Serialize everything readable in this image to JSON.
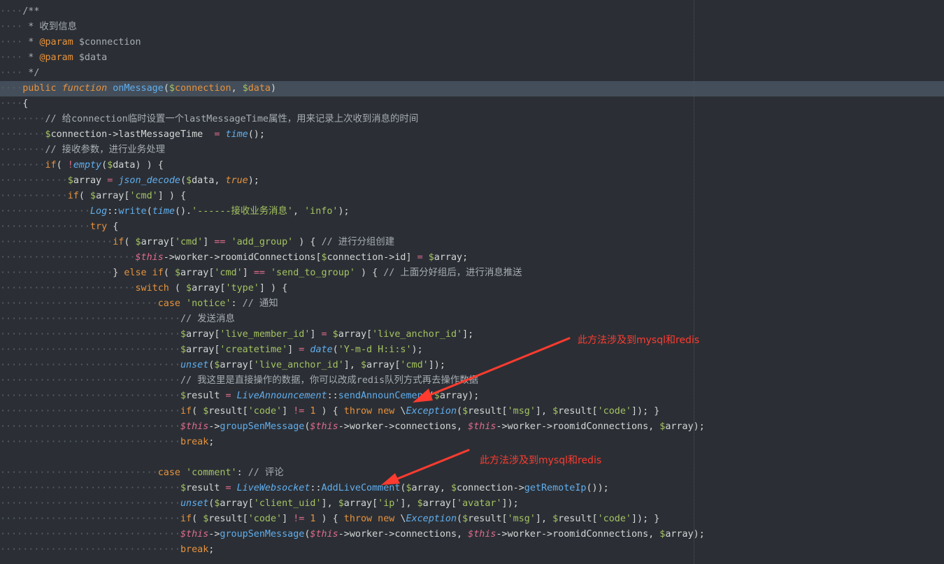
{
  "annotations": [
    "此方法涉及到mysql和redis",
    "此方法涉及到mysql和redis"
  ],
  "colors": {
    "background": "#2b2f35",
    "active_line": "#434e5a",
    "annotation": "#ff3b2f"
  },
  "code_lines": [
    {
      "indent": 1,
      "tokens": [
        [
          "comment",
          "/**"
        ]
      ]
    },
    {
      "indent": 1,
      "tokens": [
        [
          "comment",
          " * 收到信息"
        ]
      ]
    },
    {
      "indent": 1,
      "tokens": [
        [
          "comment",
          " * "
        ],
        [
          "param",
          "@param"
        ],
        [
          "comment",
          " $connection"
        ]
      ]
    },
    {
      "indent": 1,
      "tokens": [
        [
          "comment",
          " * "
        ],
        [
          "param",
          "@param"
        ],
        [
          "comment",
          " $data"
        ]
      ]
    },
    {
      "indent": 1,
      "tokens": [
        [
          "comment",
          " */"
        ]
      ]
    },
    {
      "indent": 1,
      "active": true,
      "tokens": [
        [
          "kw",
          "public"
        ],
        [
          "punc",
          " "
        ],
        [
          "fn-kw",
          "function"
        ],
        [
          "punc",
          " "
        ],
        [
          "func",
          "onMessage"
        ],
        [
          "punc",
          "("
        ],
        [
          "dollar",
          "$"
        ],
        [
          "kw",
          "connection"
        ],
        [
          "punc",
          ", "
        ],
        [
          "dollar",
          "$"
        ],
        [
          "kw",
          "data"
        ],
        [
          "punc",
          ")"
        ]
      ]
    },
    {
      "indent": 1,
      "tokens": [
        [
          "punc",
          "{"
        ]
      ]
    },
    {
      "indent": 2,
      "tokens": [
        [
          "comment",
          "// 给connection临时设置一个lastMessageTime属性，用来记录上次收到消息的时间"
        ]
      ]
    },
    {
      "indent": 2,
      "tokens": [
        [
          "dollar",
          "$"
        ],
        [
          "var",
          "connection->lastMessageTime  "
        ],
        [
          "op",
          "="
        ],
        [
          "punc",
          " "
        ],
        [
          "builtin",
          "time"
        ],
        [
          "punc",
          "();"
        ]
      ]
    },
    {
      "indent": 2,
      "tokens": [
        [
          "comment",
          "// 接收参数，进行业务处理"
        ]
      ]
    },
    {
      "indent": 2,
      "tokens": [
        [
          "kw",
          "if"
        ],
        [
          "punc",
          "( "
        ],
        [
          "op",
          "!"
        ],
        [
          "builtin",
          "empty"
        ],
        [
          "punc",
          "("
        ],
        [
          "dollar",
          "$"
        ],
        [
          "var",
          "data"
        ],
        [
          "punc",
          ") ) {"
        ]
      ]
    },
    {
      "indent": 3,
      "tokens": [
        [
          "dollar",
          "$"
        ],
        [
          "var",
          "array "
        ],
        [
          "op",
          "="
        ],
        [
          "punc",
          " "
        ],
        [
          "builtin",
          "json_decode"
        ],
        [
          "punc",
          "("
        ],
        [
          "dollar",
          "$"
        ],
        [
          "var",
          "data"
        ],
        [
          "punc",
          ", "
        ],
        [
          "true",
          "true"
        ],
        [
          "punc",
          ");"
        ]
      ]
    },
    {
      "indent": 3,
      "tokens": [
        [
          "kw",
          "if"
        ],
        [
          "punc",
          "( "
        ],
        [
          "dollar",
          "$"
        ],
        [
          "var",
          "array"
        ],
        [
          "punc",
          "["
        ],
        [
          "str",
          "'cmd'"
        ],
        [
          "punc",
          "] ) {"
        ]
      ]
    },
    {
      "indent": 4,
      "tokens": [
        [
          "class",
          "Log"
        ],
        [
          "punc",
          "::"
        ],
        [
          "method",
          "write"
        ],
        [
          "punc",
          "("
        ],
        [
          "builtin",
          "time"
        ],
        [
          "punc",
          "()."
        ],
        [
          "str",
          "'------接收业务消息'"
        ],
        [
          "punc",
          ", "
        ],
        [
          "str",
          "'info'"
        ],
        [
          "punc",
          ");"
        ]
      ]
    },
    {
      "indent": 4,
      "tokens": [
        [
          "kw",
          "try"
        ],
        [
          "punc",
          " {"
        ]
      ]
    },
    {
      "indent": 5,
      "tokens": [
        [
          "kw",
          "if"
        ],
        [
          "punc",
          "( "
        ],
        [
          "dollar",
          "$"
        ],
        [
          "var",
          "array"
        ],
        [
          "punc",
          "["
        ],
        [
          "str",
          "'cmd'"
        ],
        [
          "punc",
          "] "
        ],
        [
          "op",
          "=="
        ],
        [
          "punc",
          " "
        ],
        [
          "str",
          "'add_group'"
        ],
        [
          "punc",
          " ) { "
        ],
        [
          "comment",
          "// 进行分组创建"
        ]
      ]
    },
    {
      "indent": 6,
      "tokens": [
        [
          "this",
          "$this"
        ],
        [
          "var",
          "->worker->roomidConnections["
        ],
        [
          "dollar",
          "$"
        ],
        [
          "var",
          "connection->id] "
        ],
        [
          "op",
          "="
        ],
        [
          "punc",
          " "
        ],
        [
          "dollar",
          "$"
        ],
        [
          "var",
          "array;"
        ]
      ]
    },
    {
      "indent": 5,
      "tokens": [
        [
          "punc",
          "} "
        ],
        [
          "kw",
          "else if"
        ],
        [
          "punc",
          "( "
        ],
        [
          "dollar",
          "$"
        ],
        [
          "var",
          "array"
        ],
        [
          "punc",
          "["
        ],
        [
          "str",
          "'cmd'"
        ],
        [
          "punc",
          "] "
        ],
        [
          "op",
          "=="
        ],
        [
          "punc",
          " "
        ],
        [
          "str",
          "'send_to_group'"
        ],
        [
          "punc",
          " ) { "
        ],
        [
          "comment",
          "// 上面分好组后，进行消息推送"
        ]
      ]
    },
    {
      "indent": 6,
      "tokens": [
        [
          "kw",
          "switch"
        ],
        [
          "punc",
          " ( "
        ],
        [
          "dollar",
          "$"
        ],
        [
          "var",
          "array"
        ],
        [
          "punc",
          "["
        ],
        [
          "str",
          "'type'"
        ],
        [
          "punc",
          "] ) {"
        ]
      ]
    },
    {
      "indent": 7,
      "tokens": [
        [
          "kw",
          "case"
        ],
        [
          "punc",
          " "
        ],
        [
          "str",
          "'notice'"
        ],
        [
          "punc",
          ": "
        ],
        [
          "comment",
          "// 通知"
        ]
      ]
    },
    {
      "indent": 8,
      "tokens": [
        [
          "comment",
          "// 发送消息"
        ]
      ]
    },
    {
      "indent": 8,
      "tokens": [
        [
          "dollar",
          "$"
        ],
        [
          "var",
          "array"
        ],
        [
          "punc",
          "["
        ],
        [
          "str",
          "'live_member_id'"
        ],
        [
          "punc",
          "] "
        ],
        [
          "op",
          "="
        ],
        [
          "punc",
          " "
        ],
        [
          "dollar",
          "$"
        ],
        [
          "var",
          "array"
        ],
        [
          "punc",
          "["
        ],
        [
          "str",
          "'live_anchor_id'"
        ],
        [
          "punc",
          "];"
        ]
      ]
    },
    {
      "indent": 8,
      "tokens": [
        [
          "dollar",
          "$"
        ],
        [
          "var",
          "array"
        ],
        [
          "punc",
          "["
        ],
        [
          "str",
          "'createtime'"
        ],
        [
          "punc",
          "] "
        ],
        [
          "op",
          "="
        ],
        [
          "punc",
          " "
        ],
        [
          "builtin",
          "date"
        ],
        [
          "punc",
          "("
        ],
        [
          "str",
          "'Y-m-d H:i:s'"
        ],
        [
          "punc",
          ");"
        ]
      ]
    },
    {
      "indent": 8,
      "tokens": [
        [
          "builtin",
          "unset"
        ],
        [
          "punc",
          "("
        ],
        [
          "dollar",
          "$"
        ],
        [
          "var",
          "array"
        ],
        [
          "punc",
          "["
        ],
        [
          "str",
          "'live_anchor_id'"
        ],
        [
          "punc",
          "], "
        ],
        [
          "dollar",
          "$"
        ],
        [
          "var",
          "array"
        ],
        [
          "punc",
          "["
        ],
        [
          "str",
          "'cmd'"
        ],
        [
          "punc",
          "]);"
        ]
      ]
    },
    {
      "indent": 8,
      "tokens": [
        [
          "comment",
          "// 我这里是直接操作的数据，你可以改成redis队列方式再去操作数据"
        ]
      ]
    },
    {
      "indent": 8,
      "tokens": [
        [
          "dollar",
          "$"
        ],
        [
          "var",
          "result "
        ],
        [
          "op",
          "="
        ],
        [
          "punc",
          " "
        ],
        [
          "class",
          "LiveAnnouncement"
        ],
        [
          "punc",
          "::"
        ],
        [
          "method",
          "sendAnnounCement"
        ],
        [
          "punc",
          "("
        ],
        [
          "dollar",
          "$"
        ],
        [
          "var",
          "array);"
        ]
      ]
    },
    {
      "indent": 8,
      "tokens": [
        [
          "kw",
          "if"
        ],
        [
          "punc",
          "( "
        ],
        [
          "dollar",
          "$"
        ],
        [
          "var",
          "result"
        ],
        [
          "punc",
          "["
        ],
        [
          "str",
          "'code'"
        ],
        [
          "punc",
          "] "
        ],
        [
          "op",
          "!="
        ],
        [
          "punc",
          " "
        ],
        [
          "num",
          "1"
        ],
        [
          "punc",
          " ) { "
        ],
        [
          "kw",
          "throw new"
        ],
        [
          "punc",
          " \\"
        ],
        [
          "class",
          "Exception"
        ],
        [
          "punc",
          "("
        ],
        [
          "dollar",
          "$"
        ],
        [
          "var",
          "result"
        ],
        [
          "punc",
          "["
        ],
        [
          "str",
          "'msg'"
        ],
        [
          "punc",
          "], "
        ],
        [
          "dollar",
          "$"
        ],
        [
          "var",
          "result"
        ],
        [
          "punc",
          "["
        ],
        [
          "str",
          "'code'"
        ],
        [
          "punc",
          "]); }"
        ]
      ]
    },
    {
      "indent": 8,
      "tokens": [
        [
          "this",
          "$this"
        ],
        [
          "var",
          "->"
        ],
        [
          "method",
          "groupSenMessage"
        ],
        [
          "punc",
          "("
        ],
        [
          "this",
          "$this"
        ],
        [
          "var",
          "->worker->connections, "
        ],
        [
          "this",
          "$this"
        ],
        [
          "var",
          "->worker->roomidConnections, "
        ],
        [
          "dollar",
          "$"
        ],
        [
          "var",
          "array);"
        ]
      ]
    },
    {
      "indent": 8,
      "tokens": [
        [
          "kw",
          "break"
        ],
        [
          "punc",
          ";"
        ]
      ]
    },
    {
      "indent": 0,
      "tokens": []
    },
    {
      "indent": 7,
      "tokens": [
        [
          "kw",
          "case"
        ],
        [
          "punc",
          " "
        ],
        [
          "str",
          "'comment'"
        ],
        [
          "punc",
          ": "
        ],
        [
          "comment",
          "// 评论"
        ]
      ]
    },
    {
      "indent": 8,
      "tokens": [
        [
          "dollar",
          "$"
        ],
        [
          "var",
          "result "
        ],
        [
          "op",
          "="
        ],
        [
          "punc",
          " "
        ],
        [
          "class",
          "LiveWebsocket"
        ],
        [
          "punc",
          "::"
        ],
        [
          "method",
          "AddLiveComment"
        ],
        [
          "punc",
          "("
        ],
        [
          "dollar",
          "$"
        ],
        [
          "var",
          "array, "
        ],
        [
          "dollar",
          "$"
        ],
        [
          "var",
          "connection->"
        ],
        [
          "method",
          "getRemoteIp"
        ],
        [
          "punc",
          "());"
        ]
      ]
    },
    {
      "indent": 8,
      "tokens": [
        [
          "builtin",
          "unset"
        ],
        [
          "punc",
          "("
        ],
        [
          "dollar",
          "$"
        ],
        [
          "var",
          "array"
        ],
        [
          "punc",
          "["
        ],
        [
          "str",
          "'client_uid'"
        ],
        [
          "punc",
          "], "
        ],
        [
          "dollar",
          "$"
        ],
        [
          "var",
          "array"
        ],
        [
          "punc",
          "["
        ],
        [
          "str",
          "'ip'"
        ],
        [
          "punc",
          "], "
        ],
        [
          "dollar",
          "$"
        ],
        [
          "var",
          "array"
        ],
        [
          "punc",
          "["
        ],
        [
          "str",
          "'avatar'"
        ],
        [
          "punc",
          "]);"
        ]
      ]
    },
    {
      "indent": 8,
      "tokens": [
        [
          "kw",
          "if"
        ],
        [
          "punc",
          "( "
        ],
        [
          "dollar",
          "$"
        ],
        [
          "var",
          "result"
        ],
        [
          "punc",
          "["
        ],
        [
          "str",
          "'code'"
        ],
        [
          "punc",
          "] "
        ],
        [
          "op",
          "!="
        ],
        [
          "punc",
          " "
        ],
        [
          "num",
          "1"
        ],
        [
          "punc",
          " ) { "
        ],
        [
          "kw",
          "throw new"
        ],
        [
          "punc",
          " \\"
        ],
        [
          "class",
          "Exception"
        ],
        [
          "punc",
          "("
        ],
        [
          "dollar",
          "$"
        ],
        [
          "var",
          "result"
        ],
        [
          "punc",
          "["
        ],
        [
          "str",
          "'msg'"
        ],
        [
          "punc",
          "], "
        ],
        [
          "dollar",
          "$"
        ],
        [
          "var",
          "result"
        ],
        [
          "punc",
          "["
        ],
        [
          "str",
          "'code'"
        ],
        [
          "punc",
          "]); }"
        ]
      ]
    },
    {
      "indent": 8,
      "tokens": [
        [
          "this",
          "$this"
        ],
        [
          "var",
          "->"
        ],
        [
          "method",
          "groupSenMessage"
        ],
        [
          "punc",
          "("
        ],
        [
          "this",
          "$this"
        ],
        [
          "var",
          "->worker->connections, "
        ],
        [
          "this",
          "$this"
        ],
        [
          "var",
          "->worker->roomidConnections, "
        ],
        [
          "dollar",
          "$"
        ],
        [
          "var",
          "array);"
        ]
      ]
    },
    {
      "indent": 8,
      "tokens": [
        [
          "kw",
          "break"
        ],
        [
          "punc",
          ";"
        ]
      ]
    }
  ]
}
